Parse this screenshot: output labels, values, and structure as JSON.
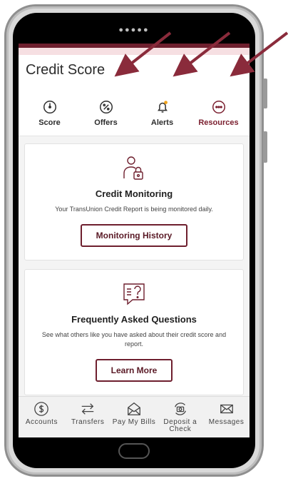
{
  "header": {
    "title": "Credit Score"
  },
  "tabs": [
    {
      "label": "Score",
      "icon": "gauge-icon",
      "active": false
    },
    {
      "label": "Offers",
      "icon": "percent-icon",
      "active": false
    },
    {
      "label": "Alerts",
      "icon": "bell-icon",
      "active": false
    },
    {
      "label": "Resources",
      "icon": "ellipsis-icon",
      "active": true
    }
  ],
  "cards": {
    "monitoring": {
      "title": "Credit Monitoring",
      "text": "Your TransUnion Credit Report is being monitored daily.",
      "button": "Monitoring History"
    },
    "faq": {
      "title": "Frequently Asked Questions",
      "text": "See what others like you have asked about their credit score and report.",
      "button": "Learn More"
    }
  },
  "bottom_nav": [
    {
      "label": "Accounts",
      "icon": "dollar-icon"
    },
    {
      "label": "Transfers",
      "icon": "transfer-icon"
    },
    {
      "label": "Pay My Bills",
      "icon": "envelope-dollar-icon"
    },
    {
      "label": "Deposit a Check",
      "icon": "camera-deposit-icon"
    },
    {
      "label": "Messages",
      "icon": "mail-icon"
    }
  ],
  "colors": {
    "accent": "#6e1f2e",
    "arrow": "#8a2b3b",
    "alert_dot": "#f0a31c"
  }
}
